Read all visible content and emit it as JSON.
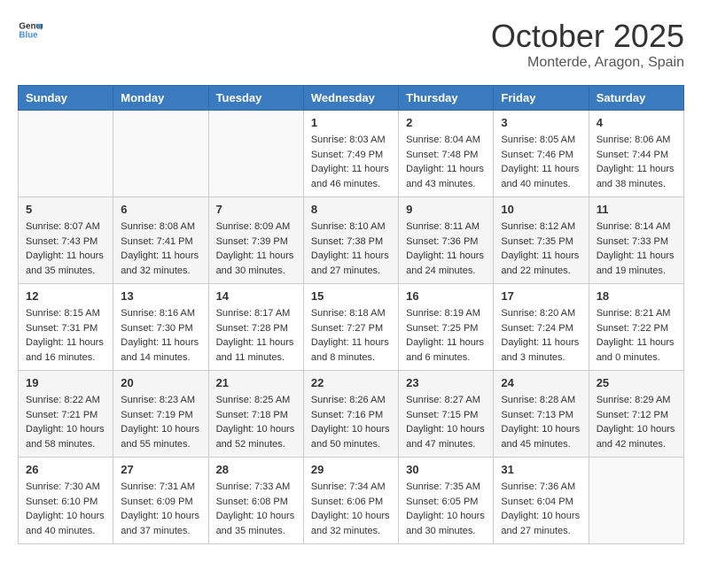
{
  "header": {
    "logo_general": "General",
    "logo_blue": "Blue",
    "month_title": "October 2025",
    "subtitle": "Monterde, Aragon, Spain"
  },
  "weekdays": [
    "Sunday",
    "Monday",
    "Tuesday",
    "Wednesday",
    "Thursday",
    "Friday",
    "Saturday"
  ],
  "weeks": [
    [
      {
        "day": "",
        "sunrise": "",
        "sunset": "",
        "daylight": ""
      },
      {
        "day": "",
        "sunrise": "",
        "sunset": "",
        "daylight": ""
      },
      {
        "day": "",
        "sunrise": "",
        "sunset": "",
        "daylight": ""
      },
      {
        "day": "1",
        "sunrise": "Sunrise: 8:03 AM",
        "sunset": "Sunset: 7:49 PM",
        "daylight": "Daylight: 11 hours and 46 minutes."
      },
      {
        "day": "2",
        "sunrise": "Sunrise: 8:04 AM",
        "sunset": "Sunset: 7:48 PM",
        "daylight": "Daylight: 11 hours and 43 minutes."
      },
      {
        "day": "3",
        "sunrise": "Sunrise: 8:05 AM",
        "sunset": "Sunset: 7:46 PM",
        "daylight": "Daylight: 11 hours and 40 minutes."
      },
      {
        "day": "4",
        "sunrise": "Sunrise: 8:06 AM",
        "sunset": "Sunset: 7:44 PM",
        "daylight": "Daylight: 11 hours and 38 minutes."
      }
    ],
    [
      {
        "day": "5",
        "sunrise": "Sunrise: 8:07 AM",
        "sunset": "Sunset: 7:43 PM",
        "daylight": "Daylight: 11 hours and 35 minutes."
      },
      {
        "day": "6",
        "sunrise": "Sunrise: 8:08 AM",
        "sunset": "Sunset: 7:41 PM",
        "daylight": "Daylight: 11 hours and 32 minutes."
      },
      {
        "day": "7",
        "sunrise": "Sunrise: 8:09 AM",
        "sunset": "Sunset: 7:39 PM",
        "daylight": "Daylight: 11 hours and 30 minutes."
      },
      {
        "day": "8",
        "sunrise": "Sunrise: 8:10 AM",
        "sunset": "Sunset: 7:38 PM",
        "daylight": "Daylight: 11 hours and 27 minutes."
      },
      {
        "day": "9",
        "sunrise": "Sunrise: 8:11 AM",
        "sunset": "Sunset: 7:36 PM",
        "daylight": "Daylight: 11 hours and 24 minutes."
      },
      {
        "day": "10",
        "sunrise": "Sunrise: 8:12 AM",
        "sunset": "Sunset: 7:35 PM",
        "daylight": "Daylight: 11 hours and 22 minutes."
      },
      {
        "day": "11",
        "sunrise": "Sunrise: 8:14 AM",
        "sunset": "Sunset: 7:33 PM",
        "daylight": "Daylight: 11 hours and 19 minutes."
      }
    ],
    [
      {
        "day": "12",
        "sunrise": "Sunrise: 8:15 AM",
        "sunset": "Sunset: 7:31 PM",
        "daylight": "Daylight: 11 hours and 16 minutes."
      },
      {
        "day": "13",
        "sunrise": "Sunrise: 8:16 AM",
        "sunset": "Sunset: 7:30 PM",
        "daylight": "Daylight: 11 hours and 14 minutes."
      },
      {
        "day": "14",
        "sunrise": "Sunrise: 8:17 AM",
        "sunset": "Sunset: 7:28 PM",
        "daylight": "Daylight: 11 hours and 11 minutes."
      },
      {
        "day": "15",
        "sunrise": "Sunrise: 8:18 AM",
        "sunset": "Sunset: 7:27 PM",
        "daylight": "Daylight: 11 hours and 8 minutes."
      },
      {
        "day": "16",
        "sunrise": "Sunrise: 8:19 AM",
        "sunset": "Sunset: 7:25 PM",
        "daylight": "Daylight: 11 hours and 6 minutes."
      },
      {
        "day": "17",
        "sunrise": "Sunrise: 8:20 AM",
        "sunset": "Sunset: 7:24 PM",
        "daylight": "Daylight: 11 hours and 3 minutes."
      },
      {
        "day": "18",
        "sunrise": "Sunrise: 8:21 AM",
        "sunset": "Sunset: 7:22 PM",
        "daylight": "Daylight: 11 hours and 0 minutes."
      }
    ],
    [
      {
        "day": "19",
        "sunrise": "Sunrise: 8:22 AM",
        "sunset": "Sunset: 7:21 PM",
        "daylight": "Daylight: 10 hours and 58 minutes."
      },
      {
        "day": "20",
        "sunrise": "Sunrise: 8:23 AM",
        "sunset": "Sunset: 7:19 PM",
        "daylight": "Daylight: 10 hours and 55 minutes."
      },
      {
        "day": "21",
        "sunrise": "Sunrise: 8:25 AM",
        "sunset": "Sunset: 7:18 PM",
        "daylight": "Daylight: 10 hours and 52 minutes."
      },
      {
        "day": "22",
        "sunrise": "Sunrise: 8:26 AM",
        "sunset": "Sunset: 7:16 PM",
        "daylight": "Daylight: 10 hours and 50 minutes."
      },
      {
        "day": "23",
        "sunrise": "Sunrise: 8:27 AM",
        "sunset": "Sunset: 7:15 PM",
        "daylight": "Daylight: 10 hours and 47 minutes."
      },
      {
        "day": "24",
        "sunrise": "Sunrise: 8:28 AM",
        "sunset": "Sunset: 7:13 PM",
        "daylight": "Daylight: 10 hours and 45 minutes."
      },
      {
        "day": "25",
        "sunrise": "Sunrise: 8:29 AM",
        "sunset": "Sunset: 7:12 PM",
        "daylight": "Daylight: 10 hours and 42 minutes."
      }
    ],
    [
      {
        "day": "26",
        "sunrise": "Sunrise: 7:30 AM",
        "sunset": "Sunset: 6:10 PM",
        "daylight": "Daylight: 10 hours and 40 minutes."
      },
      {
        "day": "27",
        "sunrise": "Sunrise: 7:31 AM",
        "sunset": "Sunset: 6:09 PM",
        "daylight": "Daylight: 10 hours and 37 minutes."
      },
      {
        "day": "28",
        "sunrise": "Sunrise: 7:33 AM",
        "sunset": "Sunset: 6:08 PM",
        "daylight": "Daylight: 10 hours and 35 minutes."
      },
      {
        "day": "29",
        "sunrise": "Sunrise: 7:34 AM",
        "sunset": "Sunset: 6:06 PM",
        "daylight": "Daylight: 10 hours and 32 minutes."
      },
      {
        "day": "30",
        "sunrise": "Sunrise: 7:35 AM",
        "sunset": "Sunset: 6:05 PM",
        "daylight": "Daylight: 10 hours and 30 minutes."
      },
      {
        "day": "31",
        "sunrise": "Sunrise: 7:36 AM",
        "sunset": "Sunset: 6:04 PM",
        "daylight": "Daylight: 10 hours and 27 minutes."
      },
      {
        "day": "",
        "sunrise": "",
        "sunset": "",
        "daylight": ""
      }
    ]
  ]
}
